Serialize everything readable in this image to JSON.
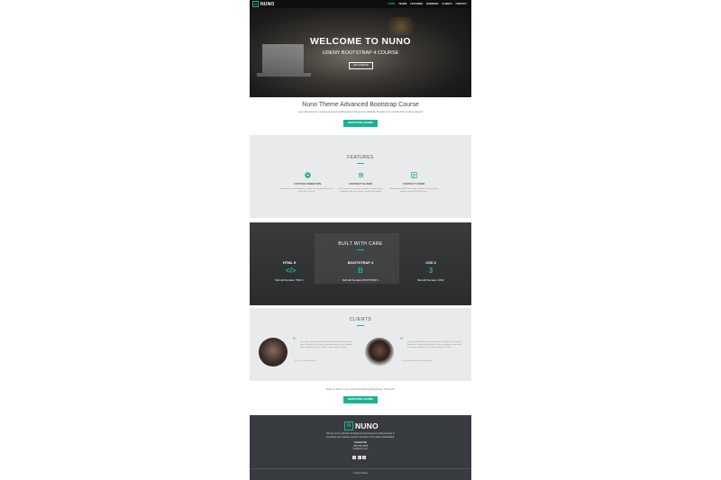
{
  "nav": {
    "brand_mark": "N",
    "brand": "NUNO",
    "links": [
      "HOME",
      "TEAMS",
      "FEATURES",
      "BUSINESS",
      "CLIENTS",
      "CONTACT"
    ],
    "active": "HOME"
  },
  "hero": {
    "title": "WELCOME TO NUNO",
    "subtitle": "UDEMY BOOTSTRAP 4 COURSE",
    "button": "GET STARTED"
  },
  "intro": {
    "title": "Nuno Theme Advanced Bootstrap Course",
    "subtitle": "Learn Bootstrap by creating an advanced Bootstrap 4 Responsive Website Template from scratch with no steps skipped!",
    "button": "BOOTSTRAP COURSE"
  },
  "features": {
    "title": "FEATURES",
    "items": [
      {
        "icon": "play-circle-icon",
        "title": "CUSTOM ANIMATION",
        "desc": "Animate.css and Waypoints js allow for simple animations to bring life to the site."
      },
      {
        "icon": "sliders-icon",
        "title": "CONTENT SLIDER",
        "desc": "Owl Carousel is a modern navigation content slider compatible with the content carousel navigation."
      },
      {
        "icon": "form-icon",
        "title": "CONTACT FORM",
        "desc": "Fill Bootstrap HTML5 form with validations to your email address using PHP/JavaScript."
      }
    ]
  },
  "built": {
    "title": "BUILT WITH CARE",
    "items": [
      {
        "icon": "code-icon",
        "glyph": "</>",
        "title": "HTML 5",
        "desc": "Built with the latest, HTML 5"
      },
      {
        "icon": "bootstrap-icon",
        "glyph": "B",
        "title": "BOOTSTRAP 4",
        "desc": "Built with the latest, BOOTSTRAP 4"
      },
      {
        "icon": "css3-icon",
        "glyph": "3",
        "title": "CSS 3",
        "desc": "Built with the latest, CSS3"
      }
    ]
  },
  "clients": {
    "title": "CLIENTS",
    "items": [
      {
        "quote": "Cras libero nequem nulla hendrerit at molestie id facilisis id libero. Nullam ut mi rutrum consequat odio suscipit. Molestie velit sed lobortis augue. Mauris viverra velit vel lorem.",
        "cite": "- B.K. (Real Estate Client)"
      },
      {
        "quote": "This great Bootstrap theme is the truth. I simply do a beautiful Bootstrap Theme with animation. Have to suggest a purchase for creative portfolios as of now and this is the one.",
        "cite": "- David (Professional Photographer)"
      }
    ]
  },
  "cta": {
    "text": "Want to learn more about developing Bootstrap Themes?",
    "button": "BOOTSTRAP COURSE"
  },
  "footer": {
    "brand_mark": "N",
    "brand": "NUNO",
    "lines": [
      "We are nuno a collective of design and development creatives based in",
      "everything your business needs to compete in the modern marketplace."
    ],
    "contact_title": "Contact Info",
    "phone": "(555) 555-5555",
    "email": "info@nuno.com",
    "socials": [
      "f",
      "t",
      "o"
    ],
    "copyright": "© Nuno Theme"
  },
  "colors": {
    "accent": "#1ab394",
    "dark": "#383c40",
    "light": "#e9eaeb"
  }
}
